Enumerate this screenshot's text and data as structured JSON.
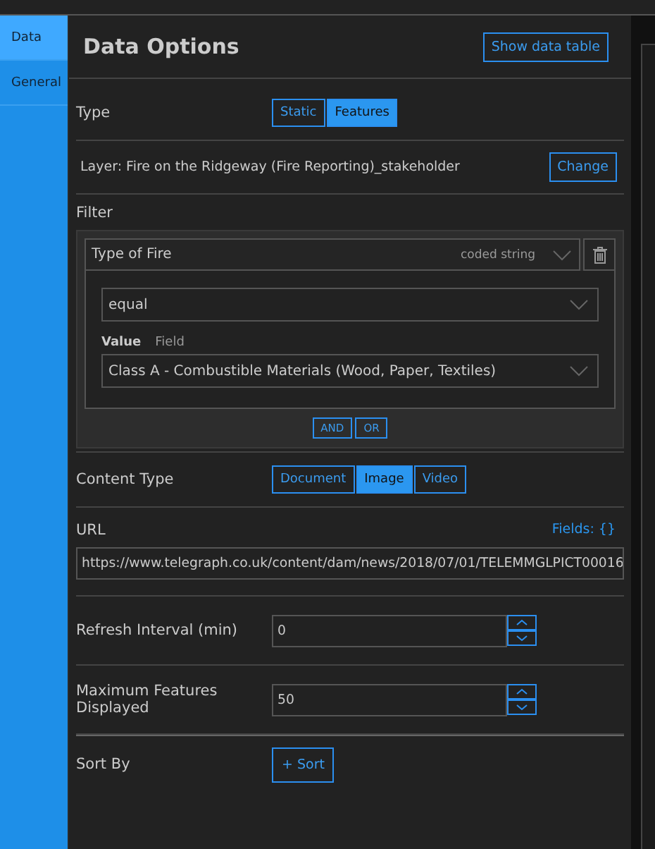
{
  "sidebar": {
    "items": [
      {
        "label": "Data",
        "selected": true
      },
      {
        "label": "General",
        "selected": false
      }
    ]
  },
  "panel": {
    "title": "Data Options",
    "show_table_button": "Show data table"
  },
  "type": {
    "label": "Type",
    "options": [
      {
        "label": "Static",
        "selected": false
      },
      {
        "label": "Features",
        "selected": true
      }
    ]
  },
  "layer": {
    "label": "Layer: Fire on the Ridgeway (Fire Reporting)_stakeholder",
    "button": "Change"
  },
  "filter": {
    "label": "Filter",
    "field": "Type of Fire",
    "field_type": "coded string",
    "operator": "equal",
    "value_tabs": [
      {
        "label": "Value",
        "selected": true
      },
      {
        "label": "Field",
        "selected": false
      }
    ],
    "value": "Class A - Combustible Materials (Wood, Paper, Textiles)",
    "joins": [
      "AND",
      "OR"
    ]
  },
  "content_type": {
    "label": "Content Type",
    "options": [
      {
        "label": "Document",
        "selected": false
      },
      {
        "label": "Image",
        "selected": true
      },
      {
        "label": "Video",
        "selected": false
      }
    ]
  },
  "url": {
    "label": "URL",
    "fields_link": "Fields: {}",
    "value": "https://www.telegraph.co.uk/content/dam/news/2018/07/01/TELEMMGLPICT00016"
  },
  "refresh": {
    "label": "Refresh Interval (min)",
    "value": "0"
  },
  "max_features": {
    "label": "Maximum Features Displayed",
    "value": "50"
  },
  "sort": {
    "label": "Sort By",
    "button": "+ Sort"
  }
}
